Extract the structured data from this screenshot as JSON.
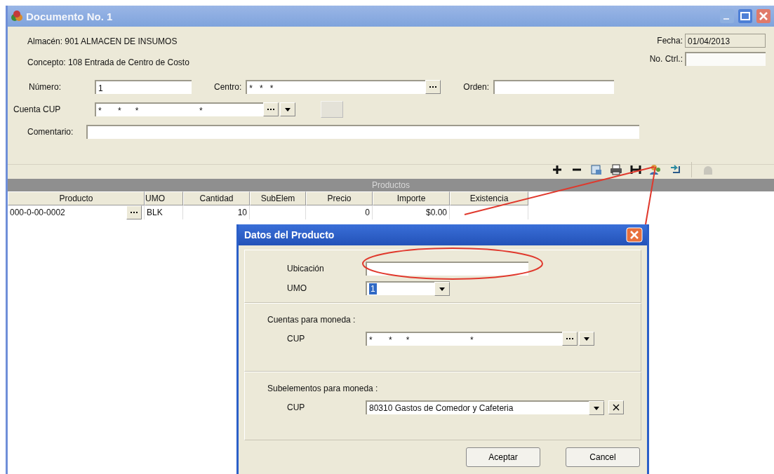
{
  "window": {
    "title": "Documento No. 1"
  },
  "info_lines": [
    {
      "label": "Almacén:",
      "value": "901  ALMACEN DE INSUMOS"
    },
    {
      "label": "Concepto:",
      "value": "108  Entrada de Centro de Costo"
    }
  ],
  "fecha": {
    "label": "Fecha:",
    "value": "01/04/2013"
  },
  "no_ctrl": {
    "label": "No. Ctrl.:"
  },
  "numero": {
    "label": "Número:",
    "value": "1"
  },
  "centro": {
    "label": "Centro:",
    "value": "*   *   *"
  },
  "orden": {
    "label": "Orden:"
  },
  "cuenta_cup": {
    "label": "Cuenta CUP",
    "value": "*       *      *                          *"
  },
  "comentario": {
    "label": "Comentario:"
  },
  "products": {
    "title": "Productos",
    "columns": [
      "Producto",
      "UMO",
      "Cantidad",
      "SubElem",
      "Precio",
      "Importe",
      "Existencia"
    ],
    "rows": [
      {
        "producto": "000-0-00-0002",
        "umo": "BLK",
        "cantidad": "10",
        "precio": "0",
        "importe": "$0.00"
      }
    ]
  },
  "dialog": {
    "title": "Datos del Producto",
    "ubicacion": {
      "label": "Ubicación"
    },
    "umo": {
      "label": "UMO",
      "value": "1"
    },
    "sections": [
      {
        "kind": "lookup",
        "title": "Cuentas para moneda :",
        "label": "CUP",
        "value": "*       *      *                          *"
      },
      {
        "kind": "combo",
        "title": "Subelementos para moneda :",
        "label": "CUP",
        "value": "80310 Gastos de Comedor y Cafeteria"
      }
    ],
    "buttons": [
      "Aceptar",
      "Cancel"
    ]
  }
}
